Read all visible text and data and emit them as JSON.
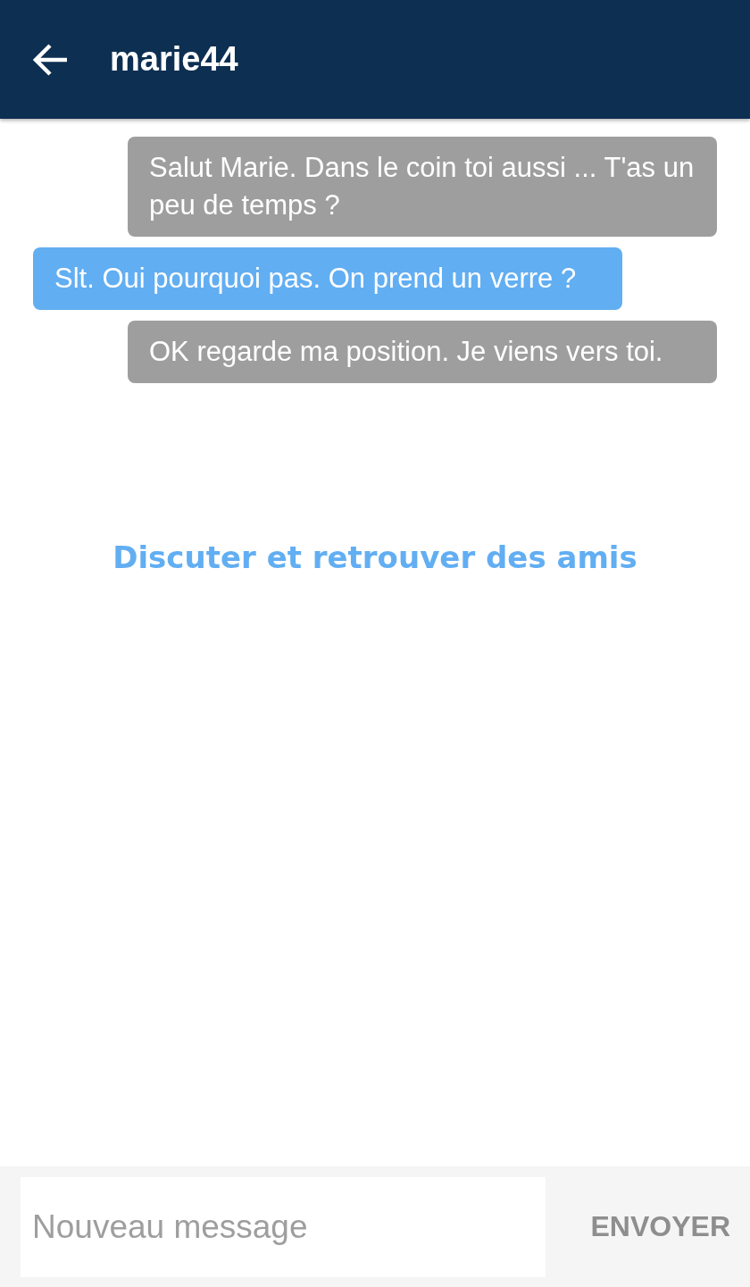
{
  "header": {
    "title": "marie44"
  },
  "messages": [
    {
      "kind": "sent",
      "text": "Salut Marie. Dans le coin toi aussi ... T'as un peu de temps ?"
    },
    {
      "kind": "received",
      "text": "Slt. Oui pourquoi pas. On prend un verre ?"
    },
    {
      "kind": "sent",
      "text": "OK regarde ma position. Je viens vers toi."
    }
  ],
  "tagline": "Discuter et retrouver des amis",
  "composer": {
    "placeholder": "Nouveau message",
    "send_label": "ENVOYER"
  }
}
